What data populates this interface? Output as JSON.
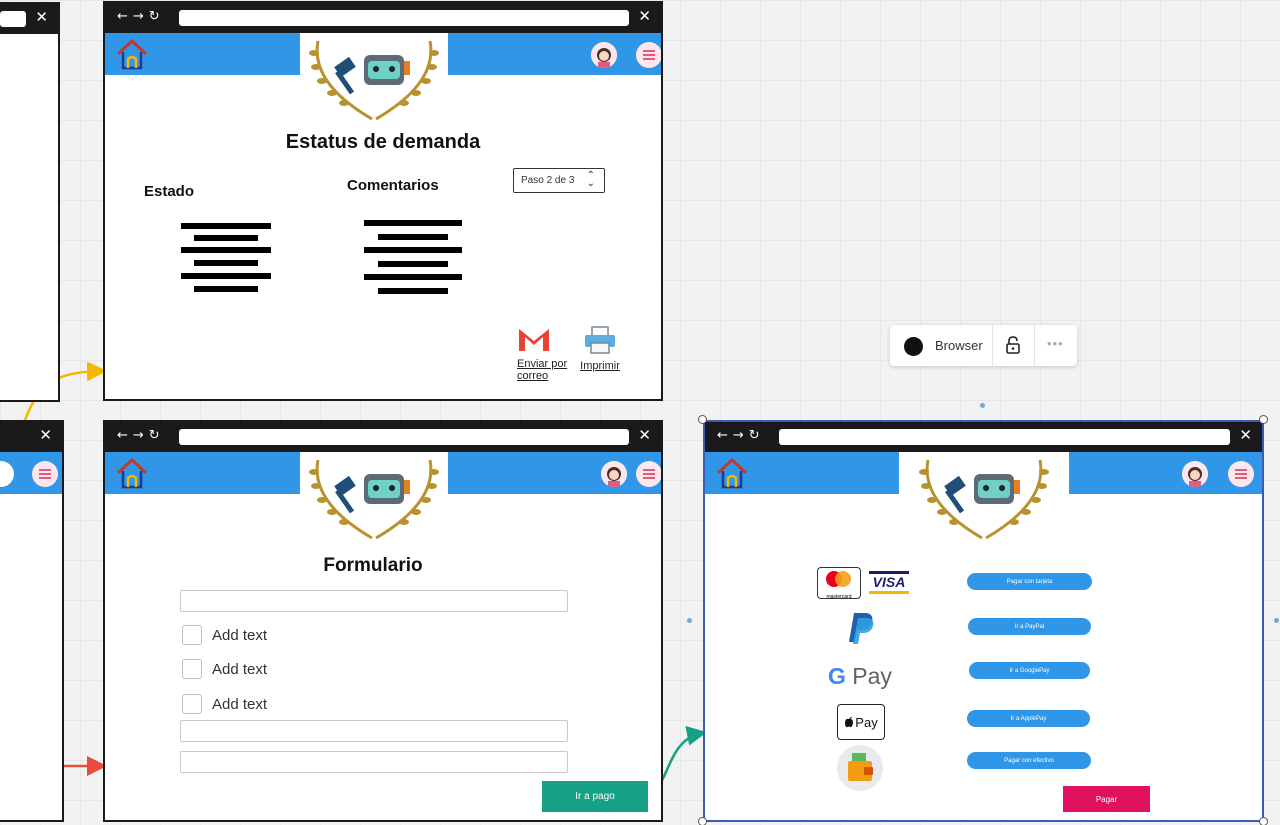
{
  "screen1": {
    "title": "Estatus de demanda",
    "col1": "Estado",
    "col2": "Comentarios",
    "step_select": "Paso 2 de 3",
    "email_label": "Enviar por correo",
    "print_label": "Imprimir"
  },
  "screen2": {
    "title": "Formulario",
    "checkboxes": [
      "Add text",
      "Add text",
      "Add text"
    ],
    "go_pay": "Ir a pago"
  },
  "screen3": {
    "buttons": [
      "Pagar con tarjeta",
      "Ir a PayPal",
      "Ir a GooglePay",
      "Ir a ApplePay",
      "Pagar con efectivo"
    ],
    "pay": "Pagar",
    "mastercard": "mastercard",
    "visa": "VISA",
    "gpay": "Pay",
    "applepay": "Pay"
  },
  "toolbar": {
    "label": "Browser"
  },
  "colors": {
    "appbar": "#2f96e8",
    "go_pay_button": "#16a085",
    "pay_button": "#e0115f",
    "arrow_yellow": "#f5b800",
    "arrow_red": "#e74c3c",
    "arrow_teal": "#16a085"
  }
}
